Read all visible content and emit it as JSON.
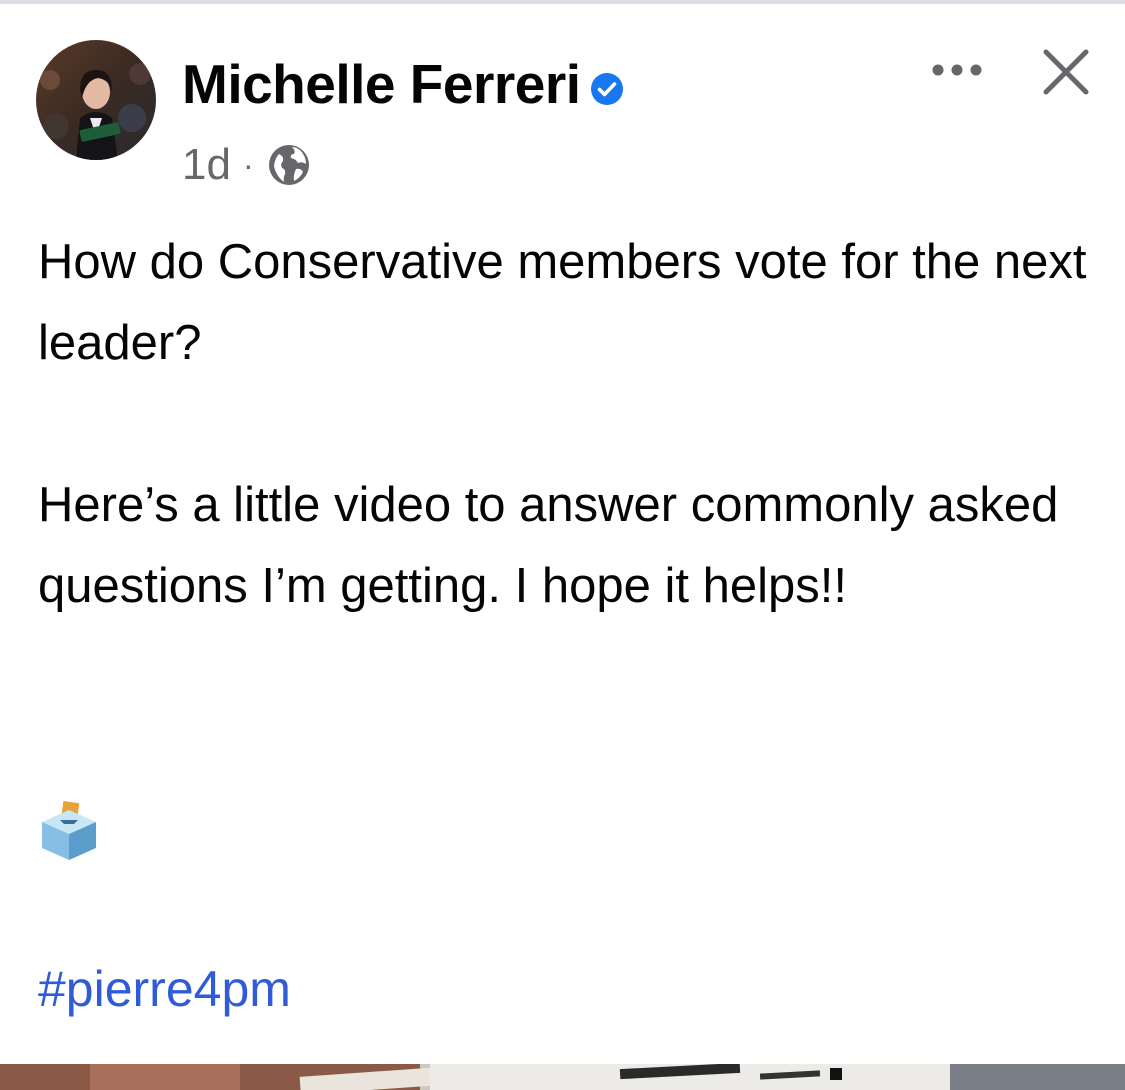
{
  "post": {
    "author": "Michelle Ferreri",
    "timestamp": "1d",
    "separator": "·",
    "privacy_icon": "globe-icon",
    "verified_icon": "verified-badge-icon",
    "paragraphs": [
      "How do Conservative members vote for the next leader?",
      "Here’s a little video to answer commonly asked questions I’m getting. I hope it helps!!"
    ],
    "emoji": "ballot-box-emoji",
    "hashtag": "#pierre4pm"
  },
  "header_actions": {
    "more_icon": "more-options-icon",
    "close_icon": "close-icon"
  },
  "colors": {
    "verified_blue": "#1877f2",
    "hashtag_blue": "#2f5bd8",
    "meta_gray": "#65676b",
    "text": "#050505"
  }
}
